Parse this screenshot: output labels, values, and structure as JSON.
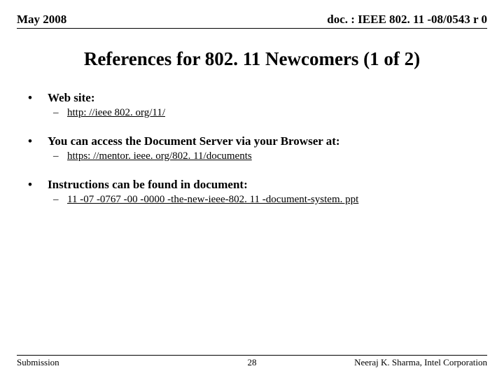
{
  "header": {
    "date": "May 2008",
    "docnum": "doc. : IEEE 802. 11 -08/0543 r 0"
  },
  "title": "References for 802. 11 Newcomers (1 of 2)",
  "bullets": [
    {
      "text": "Web site:",
      "sub": "http: //ieee 802. org/11/"
    },
    {
      "text": "You can access the Document Server via your Browser at:",
      "sub": "https: //mentor. ieee. org/802. 11/documents"
    },
    {
      "text": "Instructions can be found in document:",
      "sub": "11 -07 -0767 -00 -0000 -the-new-ieee-802. 11 -document-system. ppt"
    }
  ],
  "footer": {
    "left": "Submission",
    "center": "28",
    "right": "Neeraj K. Sharma, Intel Corporation"
  }
}
